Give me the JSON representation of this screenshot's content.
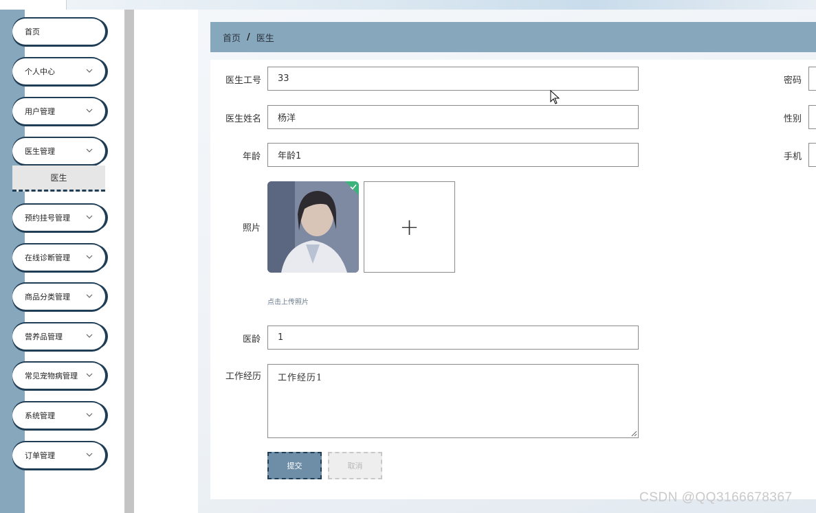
{
  "sidebar": {
    "items": [
      {
        "label": "首页",
        "has_chevron": false
      },
      {
        "label": "个人中心",
        "has_chevron": true
      },
      {
        "label": "用户管理",
        "has_chevron": true
      },
      {
        "label": "医生管理",
        "has_chevron": true
      },
      {
        "label": "预约挂号管理",
        "has_chevron": true
      },
      {
        "label": "在线诊断管理",
        "has_chevron": true
      },
      {
        "label": "商品分类管理",
        "has_chevron": true
      },
      {
        "label": "营养品管理",
        "has_chevron": true
      },
      {
        "label": "常见宠物病管理",
        "has_chevron": true
      },
      {
        "label": "系统管理",
        "has_chevron": true
      },
      {
        "label": "订单管理",
        "has_chevron": true
      }
    ],
    "submenu_active": "医生",
    "colors": {
      "rail": "#87a7bd",
      "border": "#1f3d55"
    }
  },
  "breadcrumb": {
    "home": "首页",
    "separator": "/",
    "current": "医生"
  },
  "form": {
    "left": {
      "doctor_id": {
        "label": "医生工号",
        "value": "33"
      },
      "doctor_name": {
        "label": "医生姓名",
        "value": "杨洋"
      },
      "age": {
        "label": "年龄",
        "value": "年龄1"
      },
      "photo": {
        "label": "照片",
        "hint": "点击上传照片",
        "upload_icon": "+"
      },
      "seniority": {
        "label": "医龄",
        "value": "1"
      },
      "work_history": {
        "label": "工作经历",
        "value": "工作经历1"
      }
    },
    "right": {
      "password": {
        "label": "密码"
      },
      "gender": {
        "label": "性别"
      },
      "phone": {
        "label": "手机"
      }
    },
    "buttons": {
      "submit": "提交",
      "cancel": "取消"
    }
  },
  "watermark": "CSDN @QQ3166678367"
}
